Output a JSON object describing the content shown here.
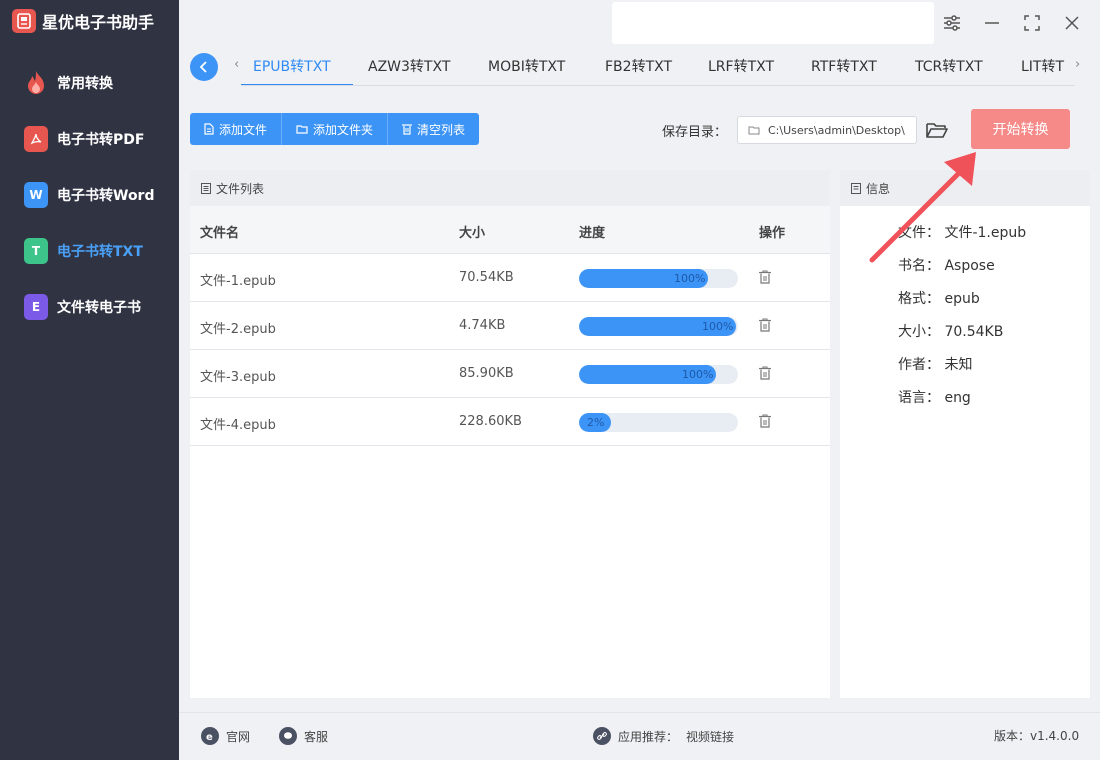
{
  "app": {
    "title": "星优电子书助手"
  },
  "sidebar": {
    "items": [
      {
        "label": "常用转换",
        "icon": "flame-icon",
        "color": "#e8574f"
      },
      {
        "label": "电子书转PDF",
        "icon": "pdf-icon",
        "color": "#e8574f"
      },
      {
        "label": "电子书转Word",
        "icon": "word-icon",
        "color": "#3d94f7"
      },
      {
        "label": "电子书转TXT",
        "icon": "txt-icon",
        "color": "#3cc48a",
        "active": true
      },
      {
        "label": "文件转电子书",
        "icon": "ebook-icon",
        "color": "#7b5ae8"
      }
    ],
    "icon_letters": {
      "word": "W",
      "txt": "T",
      "ebook": "E"
    }
  },
  "tabs": {
    "items": [
      "EPUB转TXT",
      "AZW3转TXT",
      "MOBI转TXT",
      "FB2转TXT",
      "LRF转TXT",
      "RTF转TXT",
      "TCR转TXT",
      "LIT转T"
    ],
    "active_index": 0,
    "prev_arrow": "‹",
    "next_arrow": "›"
  },
  "toolbar": {
    "add_file": "添加文件",
    "add_folder": "添加文件夹",
    "clear_list": "清空列表",
    "save_label": "保存目录：",
    "save_path": "C:\\Users\\admin\\Desktop\\",
    "start": "开始转换"
  },
  "file_list": {
    "title": "文件列表",
    "columns": {
      "name": "文件名",
      "size": "大小",
      "progress": "进度",
      "action": "操作"
    },
    "rows": [
      {
        "name": "文件-1.epub",
        "size": "70.54KB",
        "progress_text": "100%",
        "progress": 0.81
      },
      {
        "name": "文件-2.epub",
        "size": "4.74KB",
        "progress_text": "100%",
        "progress": 0.99
      },
      {
        "name": "文件-3.epub",
        "size": "85.90KB",
        "progress_text": "100%",
        "progress": 0.86
      },
      {
        "name": "文件-4.epub",
        "size": "228.60KB",
        "progress_text": "2%",
        "progress": 0.2
      }
    ]
  },
  "info": {
    "title": "信息",
    "lines": [
      "文件：  文件-1.epub",
      "书名：  Aspose",
      "格式：  epub",
      "大小：  70.54KB",
      "作者：  未知",
      "语言：  eng"
    ]
  },
  "footer": {
    "website": "官网",
    "service": "客服",
    "recommend_label": "应用推荐：",
    "recommend_link": "视频链接",
    "version": "版本：v1.4.0.0"
  },
  "colors": {
    "sidebar_bg": "#2f3342",
    "accent": "#3d94f7",
    "start_button": "#f58a88",
    "annotation_arrow": "#f0525a"
  }
}
